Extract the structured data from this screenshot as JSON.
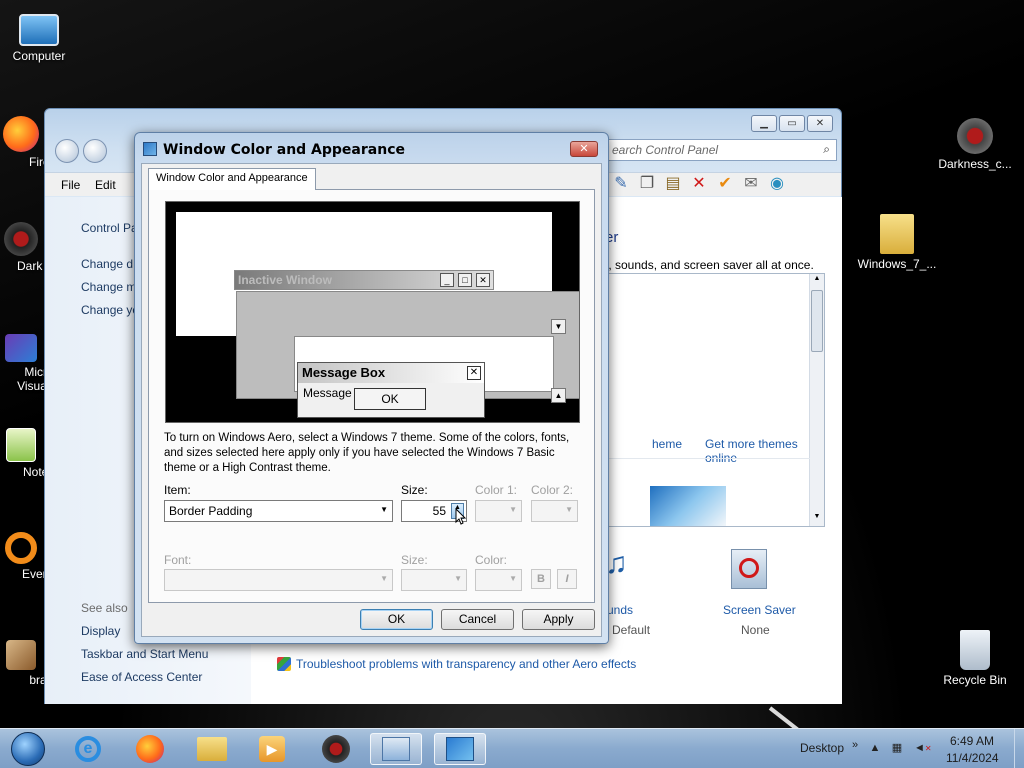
{
  "desktop": {
    "icons": [
      {
        "label": "Computer",
        "icon": "computer-icon"
      },
      {
        "label": "Firef",
        "icon": "firefox-icon"
      },
      {
        "label": "Dark Ch",
        "icon": "dark-chrome-icon"
      },
      {
        "label": "Micro",
        "label2": "Visual S",
        "icon": "visual-studio-icon"
      },
      {
        "label": "Notep",
        "icon": "notepad-icon"
      },
      {
        "label": "Everyt",
        "icon": "everything-icon"
      },
      {
        "label": "brav",
        "icon": "brave-icon"
      },
      {
        "label": "Darkness_c...",
        "icon": "darkness-icon"
      },
      {
        "label": "Windows_7_...",
        "icon": "folder-icon"
      },
      {
        "label": "Recycle Bin",
        "icon": "recycle-bin-icon"
      }
    ]
  },
  "control_panel": {
    "search_placeholder": "earch Control Panel",
    "menu": {
      "file": "File",
      "edit": "Edit"
    },
    "left_pane": {
      "links": [
        "Control Pa",
        "Change d",
        "Change m",
        "Change yo"
      ],
      "see_also": "See also",
      "see_also_links": [
        "Display",
        "Taskbar and Start Menu",
        "Ease of Access Center"
      ]
    },
    "main": {
      "heading_fragment": "er",
      "subtitle_fragment": "r, sounds, and screen saver all at once.",
      "theme_link_fragment": "heme",
      "more_themes_link": "Get more themes online",
      "sounds_label": "unds",
      "sounds_value": "ws Default",
      "screen_saver_label": "Screen Saver",
      "screen_saver_value": "None",
      "troubleshoot_link": "Troubleshoot problems with transparency and other Aero effects"
    }
  },
  "dialog": {
    "title": "Window Color and Appearance",
    "tab_label": "Window Color and Appearance",
    "preview": {
      "inactive_title": "Inactive Window",
      "message_box_title": "Message Box",
      "message_text": "Message",
      "ok_label": "OK"
    },
    "info_text": "To turn on Windows Aero, select a Windows 7 theme.  Some of the colors, fonts, and sizes selected here apply only if you have selected the Windows 7 Basic theme or a High Contrast theme.",
    "item_label": "Item:",
    "item_value": "Border Padding",
    "size_label": "Size:",
    "size_value": "55",
    "color1_label": "Color 1:",
    "color2_label": "Color 2:",
    "font_label": "Font:",
    "font_size_label": "Size:",
    "font_color_label": "Color:",
    "bold_label": "B",
    "italic_label": "I",
    "buttons": {
      "ok": "OK",
      "cancel": "Cancel",
      "apply": "Apply"
    }
  },
  "taskbar": {
    "desktop_label": "Desktop",
    "time": "6:49 AM",
    "date": "11/4/2024"
  },
  "colors": {
    "taskbar": "#8aaace",
    "link": "#1e5aa8",
    "dialog_frame": "#c9dbef"
  }
}
